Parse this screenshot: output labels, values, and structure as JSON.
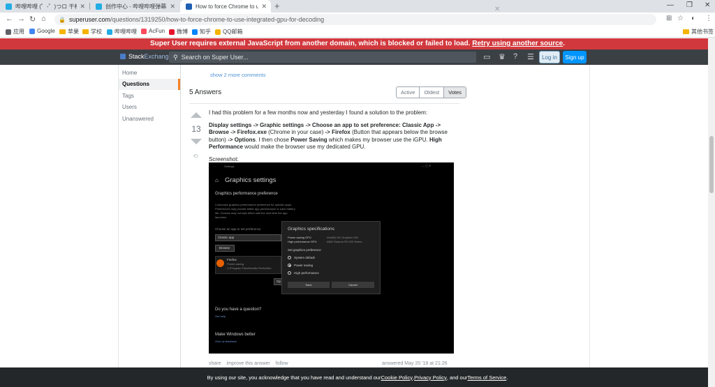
{
  "browser": {
    "tabs": [
      {
        "label": "哔哩哔哩 (゜-゜)つロ 干杯~-bili",
        "color": "#23ade5",
        "active": false
      },
      {
        "label": "创作中心 - 哔哩哔哩弹幕视频网",
        "color": "#23ade5",
        "active": false
      },
      {
        "label": "How to force Chrome to use int",
        "color": "#1e5fb4",
        "active": true
      }
    ],
    "url_host": "superuser.com",
    "url_path": "/questions/1319250/how-to-force-chrome-to-use-integrated-gpu-for-decoding",
    "bookmarks": [
      {
        "label": "应用",
        "color": "#5f6368"
      },
      {
        "label": "Google",
        "color": "#4285f4"
      },
      {
        "label": "苹果",
        "color": "#9aa0a6"
      },
      {
        "label": "学校",
        "color": "#9aa0a6"
      },
      {
        "label": "哔哩哔哩",
        "color": "#23ade5"
      },
      {
        "label": "AcFun",
        "color": "#fd4c5d"
      },
      {
        "label": "微博",
        "color": "#e6162d"
      },
      {
        "label": "知乎",
        "color": "#0084ff"
      },
      {
        "label": "QQ邮箱",
        "color": "#f4b400"
      }
    ],
    "other_bookmarks": "其他书签"
  },
  "banner": {
    "text": "Super User requires external JavaScript from another domain, which is blocked or failed to load. ",
    "link": "Retry using another source",
    "end": "."
  },
  "topbar": {
    "logo_a": "Stack",
    "logo_b": "Exchange",
    "search_placeholder": "Search on Super User...",
    "login": "Log in",
    "signup": "Sign up"
  },
  "leftnav": {
    "home": "Home",
    "questions": "Questions",
    "tags": "Tags",
    "users": "Users",
    "unanswered": "Unanswered"
  },
  "question": {
    "show_more": "show 2 more comments"
  },
  "answers": {
    "title": "5 Answers",
    "sort": [
      "Active",
      "Oldest",
      "Votes"
    ]
  },
  "answer": {
    "votes": "13",
    "p1": "I had this problem for a few months now and yesterday I found a solution to the problem:",
    "p2_a": "Display settings -> Graphic settings -> Choose an app to set preference: Classic App -> Browse -> Firefox.exe",
    "p2_b": " (Chrome in your case) ",
    "p2_c": "-> Firefox",
    "p2_d": " (Button that appears below the browse button) ",
    "p2_e": "-> Options",
    "p2_f": ". I then chose ",
    "p2_g": "Power Saving",
    "p2_h": " which makes my browser use the iGPU. ",
    "p2_i": "High Performance",
    "p2_j": " would make the browser use my dedicated GPU.",
    "p3": "Screenshot:",
    "footer_links": [
      "share",
      "improve this answer",
      "follow"
    ],
    "footer_meta": "answered May 20 '18 at 21:26"
  },
  "screenshot": {
    "window_title": "Settings",
    "heading": "Graphics settings",
    "subheading": "Graphics performance preference",
    "desc": [
      "Customize graphics performance preference for specific apps.",
      "Preferences may provide better app performance or save battery",
      "life. Choices may not take effect until the next time the app",
      "launches."
    ],
    "choose_label": "Choose an app to set preference",
    "select_value": "Classic app",
    "browse": "Browse",
    "app_name": "Firefox",
    "app_pref": "Power saving",
    "app_path": "C:\\Program Files\\Mozilla Firefox\\fire",
    "options_btn": "Op",
    "question": "Do you have a question?",
    "get_help": "Get help",
    "better": "Make Windows better",
    "feedback": "Give us feedback",
    "dialog": {
      "title": "Graphics specifications",
      "ps_label": "Power saving GPU",
      "ps_value": "Intel(R) HD Graphics 530",
      "hp_label": "High performance GPU",
      "hp_value": "AMD Radeon R9 200 Series",
      "set_label": "Set graphics preference",
      "options": [
        "System default",
        "Power saving",
        "High performance"
      ],
      "save": "Save",
      "cancel": "Cancel"
    }
  },
  "cookie": {
    "a": "By using our site, you acknowledge that you have read and understand our ",
    "cookie_policy": "Cookie Policy",
    "b": ", ",
    "privacy_policy": "Privacy Policy",
    "c": ", and our ",
    "terms": "Terms of Service",
    "d": "."
  }
}
